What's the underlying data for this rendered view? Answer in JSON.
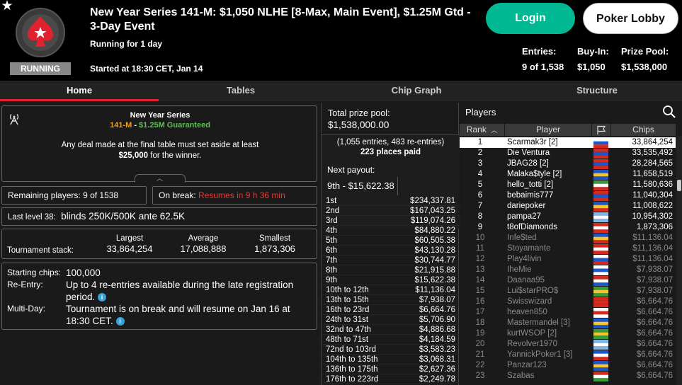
{
  "header": {
    "title": "New Year Series 141-M: $1,050 NLHE [8-Max, Main Event], $1.25M Gtd - 3-Day Event",
    "status": "RUNNING",
    "running_for": "Running for 1 day",
    "started_at": "Started at 18:30 CET, Jan 14",
    "login_label": "Login",
    "lobby_label": "Poker Lobby",
    "stats": [
      {
        "label": "Entries:",
        "value": "9 of 1,538"
      },
      {
        "label": "Buy-In:",
        "value": "$1,050"
      },
      {
        "label": "Prize Pool:",
        "value": "$1,538,000"
      }
    ]
  },
  "tabs": [
    "Home",
    "Tables",
    "Chip Graph",
    "Structure"
  ],
  "series": {
    "name": "New Year Series",
    "event": "141-M",
    "separator": " - ",
    "guarantee": "$1.25M Guaranteed",
    "deal_text": "Any deal made at the final table must set aside at least",
    "deal_amount": "$25,000",
    "deal_suffix": " for the winner."
  },
  "remaining": {
    "label": "Remaining players:",
    "value": "9 of 1538"
  },
  "break": {
    "label": "On break:",
    "value": "Resumes in 9 h 36 min"
  },
  "last_level": {
    "label": "Last level 38:",
    "value": "blinds 250K/500K ante 62.5K"
  },
  "stack": {
    "label": "Tournament stack:",
    "largest_label": "Largest",
    "largest": "33,864,254",
    "average_label": "Average",
    "average": "17,088,888",
    "smallest_label": "Smallest",
    "smallest": "1,873,306"
  },
  "info": {
    "starting_label": "Starting chips:",
    "starting": "100,000",
    "reentry_label": "Re-Entry:",
    "reentry_1": "Up to 4 re-entries available during the late registration",
    "reentry_2": "period.",
    "multiday_label": "Multi-Day:",
    "multiday_1": "Tournament is on break and will resume on Jan 16 at",
    "multiday_2": "18:30 CET.",
    "info_glyph": "i"
  },
  "prize": {
    "total_label": "Total prize pool:",
    "total": "$1,538,000.00",
    "entries_text": "(1,055 entries, 483 re-entries)",
    "places_paid": "223 places paid",
    "next_label": "Next payout:",
    "next_value": "9th - $15,622.38",
    "payouts": [
      {
        "place": "1st",
        "amount": "$234,337.81"
      },
      {
        "place": "2nd",
        "amount": "$167,043.25"
      },
      {
        "place": "3rd",
        "amount": "$119,074.26"
      },
      {
        "place": "4th",
        "amount": "$84,880.22"
      },
      {
        "place": "5th",
        "amount": "$60,505.38"
      },
      {
        "place": "6th",
        "amount": "$43,130.28"
      },
      {
        "place": "7th",
        "amount": "$30,744.77"
      },
      {
        "place": "8th",
        "amount": "$21,915.88"
      },
      {
        "place": "9th",
        "amount": "$15,622.38"
      },
      {
        "place": "10th to 12th",
        "amount": "$11,136.04"
      },
      {
        "place": "13th to 15th",
        "amount": "$7,938.07"
      },
      {
        "place": "16th to 23rd",
        "amount": "$6,664.76"
      },
      {
        "place": "24th to 31st",
        "amount": "$5,706.90"
      },
      {
        "place": "32nd to 47th",
        "amount": "$4,886.68"
      },
      {
        "place": "48th to 71st",
        "amount": "$4,184.59"
      },
      {
        "place": "72nd to 103rd",
        "amount": "$3,583.23"
      },
      {
        "place": "104th to 135th",
        "amount": "$3,068.31"
      },
      {
        "place": "136th to 175th",
        "amount": "$2,627.36"
      },
      {
        "place": "176th to 223rd",
        "amount": "$2,249.78"
      }
    ]
  },
  "players": {
    "title": "Players",
    "col_rank": "Rank",
    "col_player": "Player",
    "col_chips": "Chips",
    "rows": [
      {
        "rank": "1",
        "name": "Scarmak3r [2]",
        "chips": "33,864,254",
        "flag": [
          "#ffffff",
          "#1c57c8",
          "#d52b1e"
        ],
        "state": "sel"
      },
      {
        "rank": "2",
        "name": "Die Ventura",
        "chips": "33,535,492",
        "flag": [
          "#d52b1e",
          "#1c57c8",
          "#d52b1e"
        ],
        "state": "in"
      },
      {
        "rank": "3",
        "name": "JBAG28 [2]",
        "chips": "28,284,565",
        "flag": [
          "#d52b1e",
          "#1c57c8",
          "#d52b1e"
        ],
        "state": "in"
      },
      {
        "rank": "4",
        "name": "Malaka$tyle [2]",
        "chips": "11,658,519",
        "flag": [
          "#1c57c8",
          "#f4c430",
          "#1c57c8"
        ],
        "state": "in"
      },
      {
        "rank": "5",
        "name": "hello_totti [2]",
        "chips": "11,580,636",
        "flag": [
          "#3a9a3a",
          "#ffffff",
          "#d52b1e"
        ],
        "state": "in"
      },
      {
        "rank": "6",
        "name": "bebaimis777",
        "chips": "11,040,304",
        "flag": [
          "#d52b1e",
          "#1c57c8",
          "#d52b1e"
        ],
        "state": "in"
      },
      {
        "rank": "7",
        "name": "dariepoker",
        "chips": "11,008,622",
        "flag": [
          "#1c57c8",
          "#f4c430",
          "#d52b1e"
        ],
        "state": "in"
      },
      {
        "rank": "8",
        "name": "pampa27",
        "chips": "10,954,302",
        "flag": [
          "#7fb6e8",
          "#ffffff",
          "#7fb6e8"
        ],
        "state": "in"
      },
      {
        "rank": "9",
        "name": "t8ofDiamonds",
        "chips": "1,873,306",
        "flag": [
          "#d52b1e",
          "#ffffff",
          "#d52b1e"
        ],
        "state": "in"
      },
      {
        "rank": "10",
        "name": "Infe$ted",
        "chips": "$11,136.04",
        "flag": [
          "#1c57c8",
          "#f4c430",
          "#d52b1e"
        ],
        "state": "out"
      },
      {
        "rank": "11",
        "name": "Stoyamante",
        "chips": "$11,136.04",
        "flag": [
          "#d52b1e",
          "#ffffff",
          "#d52b1e"
        ],
        "state": "out"
      },
      {
        "rank": "12",
        "name": "Play4livin",
        "chips": "$11,136.04",
        "flag": [
          "#ffffff",
          "#1c57c8",
          "#d52b1e"
        ],
        "state": "out"
      },
      {
        "rank": "13",
        "name": "IheMie",
        "chips": "$7,938.07",
        "flag": [
          "#ffffff",
          "#1c57c8",
          "#ffffff"
        ],
        "state": "out"
      },
      {
        "rank": "14",
        "name": "Daanaa95",
        "chips": "$7,938.07",
        "flag": [
          "#d52b1e",
          "#ffffff",
          "#1c57c8"
        ],
        "state": "out"
      },
      {
        "rank": "15",
        "name": "Lui$starPRO$",
        "chips": "$7,938.07",
        "flag": [
          "#3a9a3a",
          "#f4c430",
          "#3a9a3a"
        ],
        "state": "out"
      },
      {
        "rank": "16",
        "name": "Swisswizard",
        "chips": "$6,664.76",
        "flag": [
          "#d52b1e",
          "#d52b1e",
          "#d52b1e"
        ],
        "state": "out"
      },
      {
        "rank": "17",
        "name": "heaven850",
        "chips": "$6,664.76",
        "flag": [
          "#ffffff",
          "#d52b1e",
          "#ffffff"
        ],
        "state": "out"
      },
      {
        "rank": "18",
        "name": "Mastermandel [3]",
        "chips": "$6,664.76",
        "flag": [
          "#1c57c8",
          "#f4c430",
          "#1c57c8"
        ],
        "state": "out"
      },
      {
        "rank": "19",
        "name": "kurtWSOP [2]",
        "chips": "$6,664.76",
        "flag": [
          "#3a9a3a",
          "#f4c430",
          "#3a9a3a"
        ],
        "state": "out"
      },
      {
        "rank": "20",
        "name": "Revolver1970",
        "chips": "$6,664.76",
        "flag": [
          "#7fb6e8",
          "#ffffff",
          "#7fb6e8"
        ],
        "state": "out"
      },
      {
        "rank": "21",
        "name": "YannickPoker1 [3]",
        "chips": "$6,664.76",
        "flag": [
          "#1c57c8",
          "#ffffff",
          "#d52b1e"
        ],
        "state": "out"
      },
      {
        "rank": "22",
        "name": "Panzar123",
        "chips": "$6,664.76",
        "flag": [
          "#1c57c8",
          "#f4c430",
          "#1c57c8"
        ],
        "state": "out"
      },
      {
        "rank": "23",
        "name": "Szabas",
        "chips": "$6,664.76",
        "flag": [
          "#d52b1e",
          "#ffffff",
          "#3a9a3a"
        ],
        "state": "out"
      }
    ]
  }
}
